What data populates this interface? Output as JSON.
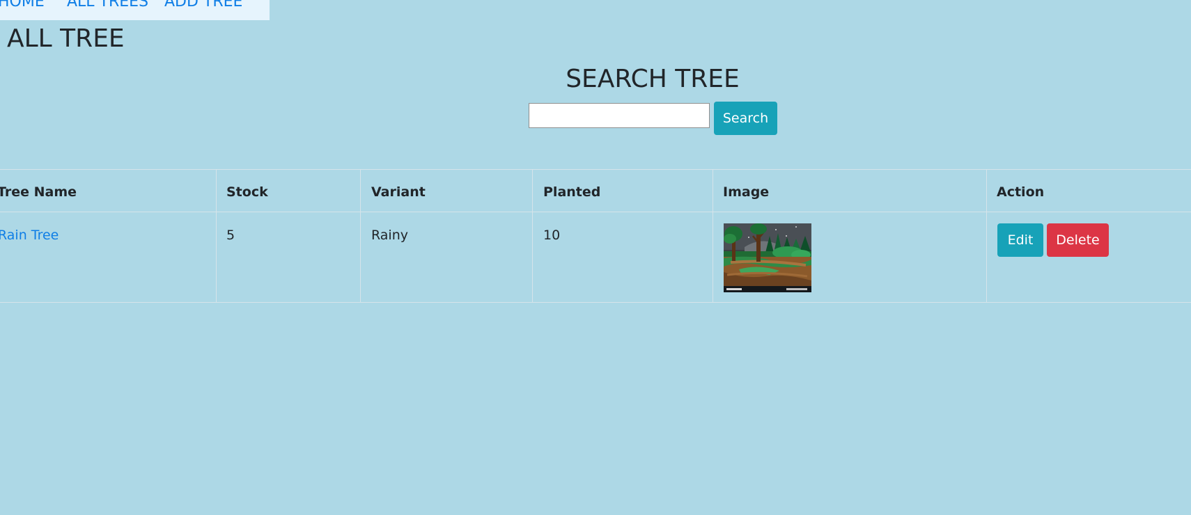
{
  "nav": {
    "items": [
      {
        "label": "HOME"
      },
      {
        "label": "ALL TREES"
      },
      {
        "label": "ADD TREE"
      }
    ]
  },
  "page": {
    "title": "ALL TREE"
  },
  "search": {
    "title": "SEARCH TREE",
    "value": "",
    "button_label": "Search"
  },
  "table": {
    "headers": [
      "Tree Name",
      "Stock",
      "Variant",
      "Planted",
      "Image",
      "Action"
    ],
    "rows": [
      {
        "name": "Rain Tree",
        "stock": "5",
        "variant": "Rainy",
        "planted": "10",
        "image": "forest-path-thumbnail",
        "actions": {
          "edit_label": "Edit",
          "delete_label": "Delete"
        }
      }
    ]
  },
  "colors": {
    "background": "#add8e6",
    "nav_background": "#e6f4fd",
    "link": "#0f7ee6",
    "info_button": "#17a2b8",
    "danger_button": "#dc3545"
  }
}
